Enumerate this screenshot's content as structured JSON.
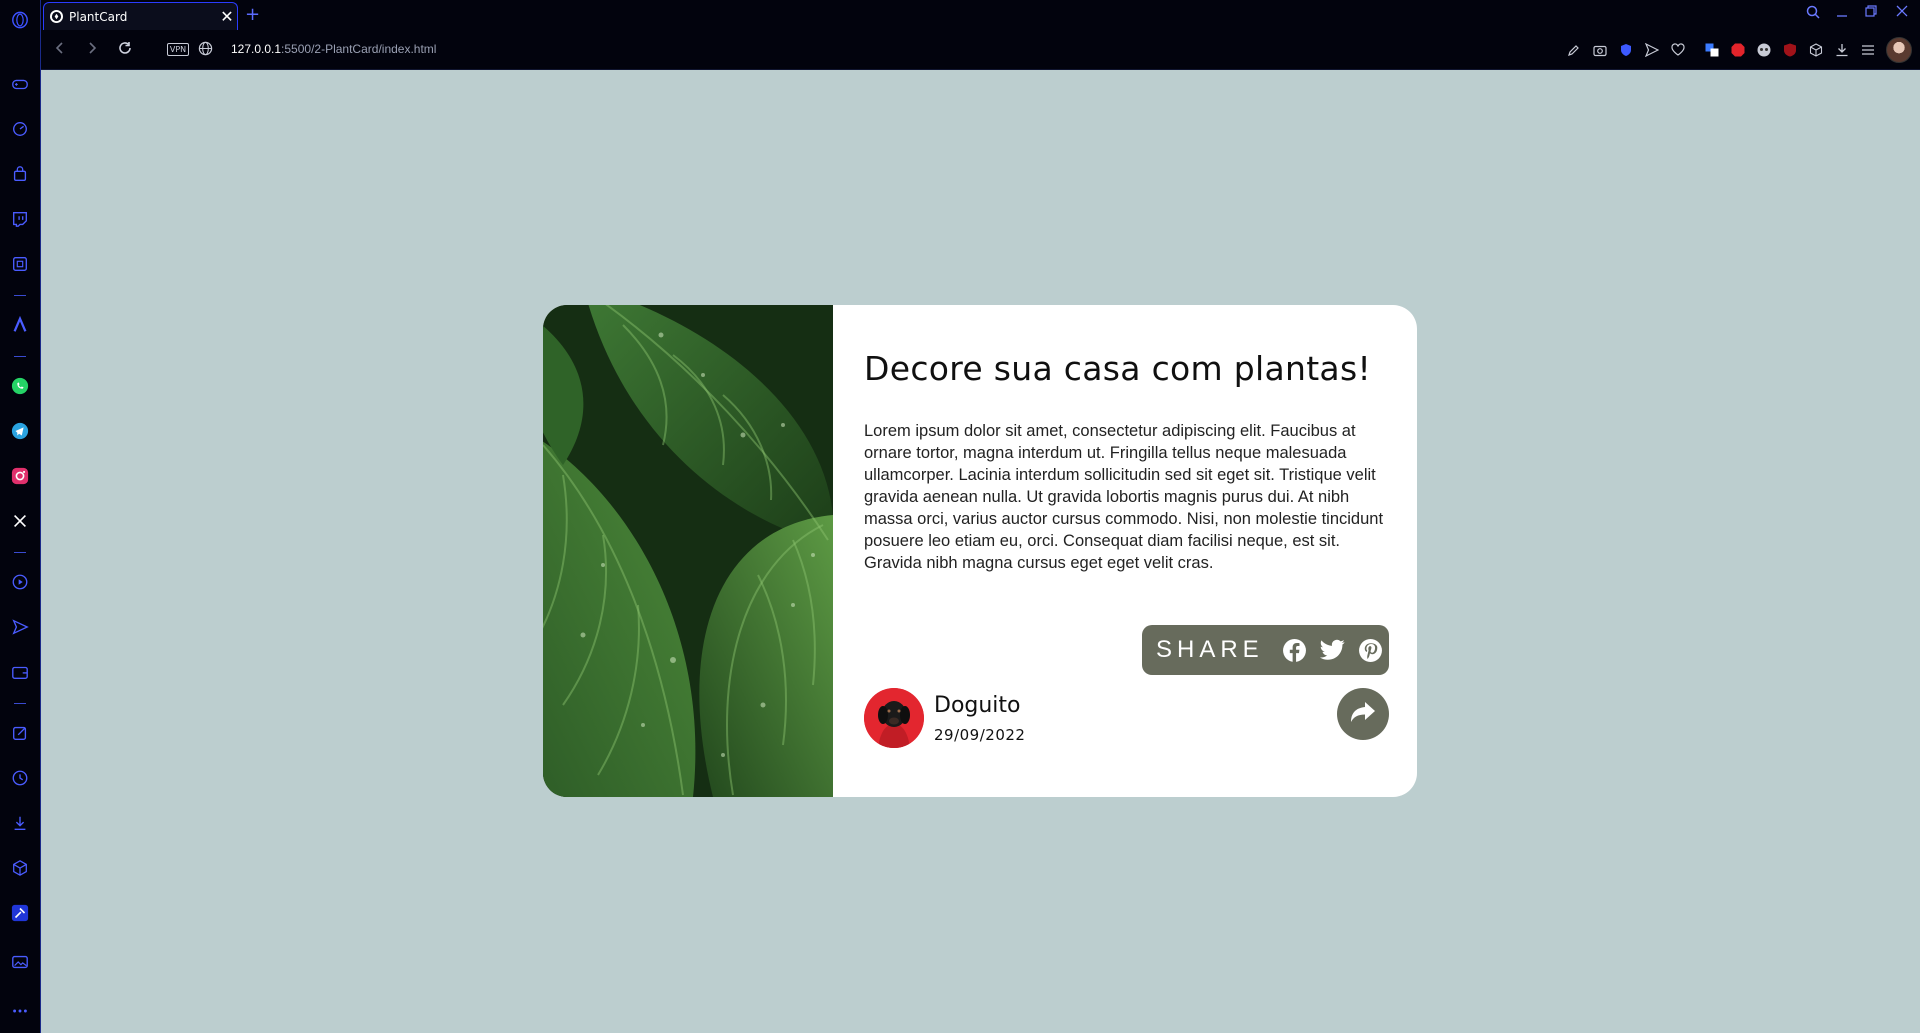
{
  "browser": {
    "tab_title": "PlantCard",
    "tab_close": "✕",
    "new_tab": "+",
    "vpn_label": "VPN",
    "url_host": "127.0.0.1",
    "url_path": ":5500/2-PlantCard/index.html"
  },
  "card": {
    "title": "Decore sua casa com plantas!",
    "text": "Lorem ipsum dolor sit amet, consectetur adipiscing elit. Faucibus at ornare tortor, magna interdum ut. Fringilla tellus neque malesuada ullamcorper. Lacinia interdum sollicitudin sed sit eget sit. Tristique velit gravida aenean nulla. Ut gravida lobortis magnis purus dui. At nibh massa orci, varius auctor cursus commodo. Nisi, non molestie tincidunt posuere leo etiam eu, orci. Consequat diam facilisi neque, est sit. Gravida nibh magna cursus eget eget velit cras.",
    "share_label": "SHARE",
    "share_networks": [
      "facebook-icon",
      "twitter-icon",
      "pinterest-icon"
    ],
    "author_name": "Doguito",
    "author_date": "29/09/2022"
  },
  "colors": {
    "page_bg": "#bccecf",
    "card_bg": "#ffffff",
    "share_bg": "#676b5c",
    "browser_accent": "#2a3cff"
  }
}
